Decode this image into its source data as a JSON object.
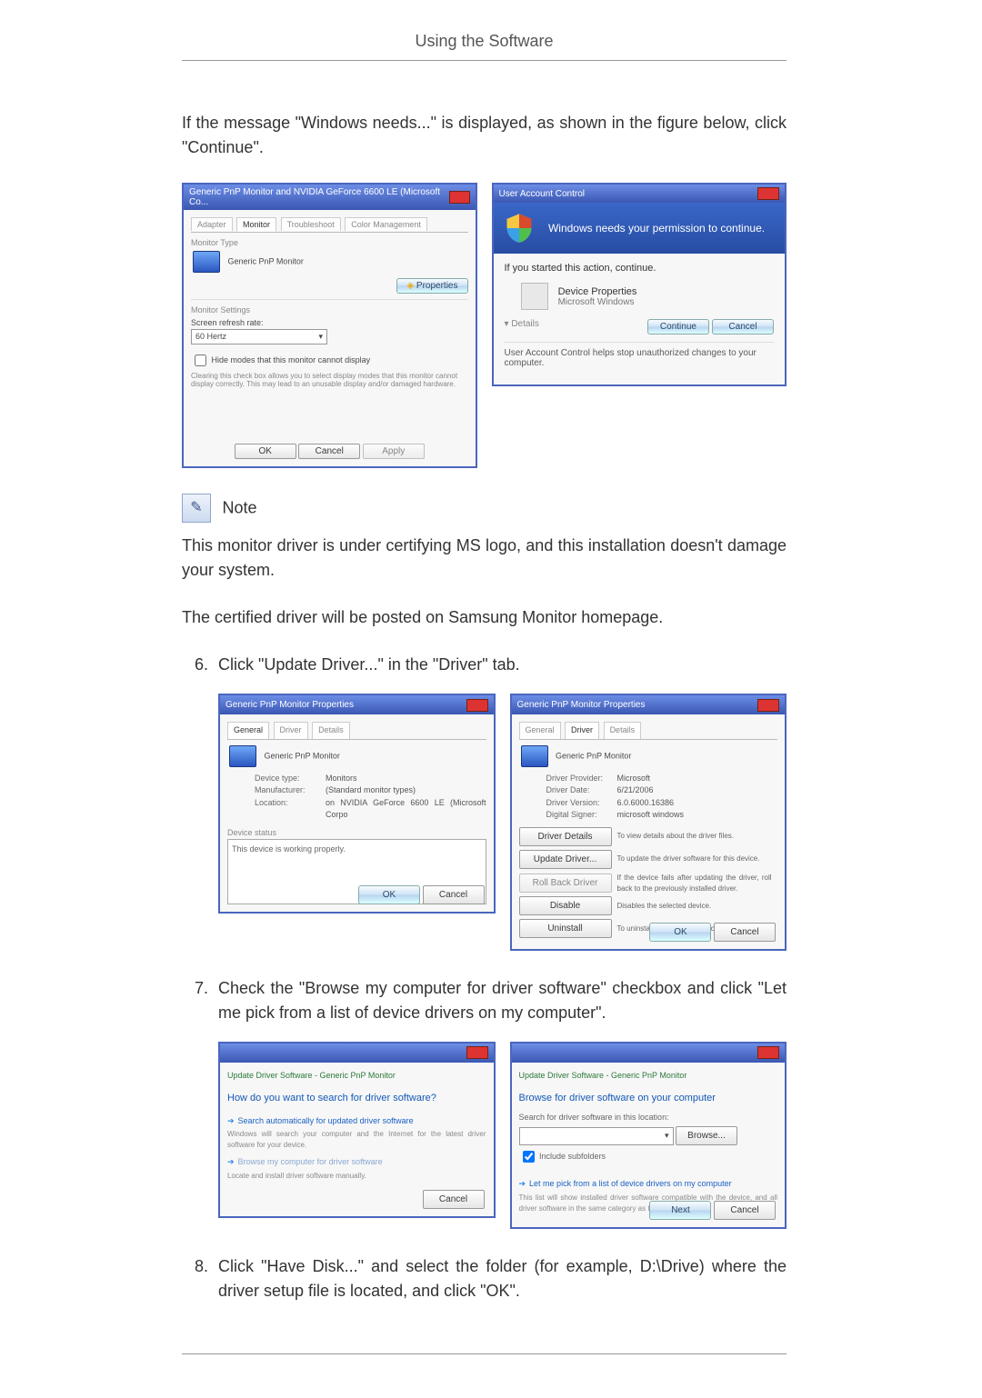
{
  "header": {
    "title": "Using the Software"
  },
  "intro": "If the message \"Windows needs...\" is displayed, as shown in the figure below, click \"Continue\".",
  "fig1": {
    "left": {
      "title": "Generic PnP Monitor and NVIDIA GeForce 6600 LE (Microsoft Co...",
      "tabs": {
        "t1": "Adapter",
        "t2": "Monitor",
        "t3": "Troubleshoot",
        "t4": "Color Management"
      },
      "monitor_type_label": "Monitor Type",
      "monitor_type_value": "Generic PnP Monitor",
      "properties_btn": "Properties",
      "settings_label": "Monitor Settings",
      "refresh_label": "Screen refresh rate:",
      "refresh_value": "60 Hertz",
      "hide_modes_label": "Hide modes that this monitor cannot display",
      "hide_modes_note": "Clearing this check box allows you to select display modes that this monitor cannot display correctly. This may lead to an unusable display and/or damaged hardware.",
      "ok": "OK",
      "cancel": "Cancel",
      "apply": "Apply"
    },
    "right": {
      "title": "User Account Control",
      "banner": "Windows needs your permission to continue.",
      "prompt": "If you started this action, continue.",
      "item_title": "Device Properties",
      "item_vendor": "Microsoft Windows",
      "details": "Details",
      "continue": "Continue",
      "cancel": "Cancel",
      "footer": "User Account Control helps stop unauthorized changes to your computer."
    }
  },
  "note": {
    "label": "Note",
    "p1": "This monitor driver is under certifying MS logo, and this installation doesn't damage your system.",
    "p2": "The certified driver will be posted on Samsung Monitor homepage."
  },
  "steps": {
    "s6": "Click \"Update Driver...\" in the \"Driver\" tab.",
    "s7": "Check the \"Browse my computer for driver software\" checkbox and click \"Let me pick from a list of device drivers on my computer\".",
    "s8": "Click \"Have Disk...\" and select the folder (for example, D:\\Drive) where the driver setup file is located, and click \"OK\"."
  },
  "fig2": {
    "left": {
      "title": "Generic PnP Monitor Properties",
      "tabs": {
        "t1": "General",
        "t2": "Driver",
        "t3": "Details"
      },
      "name": "Generic PnP Monitor",
      "device_type_k": "Device type:",
      "device_type_v": "Monitors",
      "manufacturer_k": "Manufacturer:",
      "manufacturer_v": "(Standard monitor types)",
      "location_k": "Location:",
      "location_v": "on NVIDIA GeForce 6600 LE (Microsoft Corpo",
      "status_label": "Device status",
      "status_text": "This device is working properly.",
      "ok": "OK",
      "cancel": "Cancel"
    },
    "right": {
      "title": "Generic PnP Monitor Properties",
      "tabs": {
        "t1": "General",
        "t2": "Driver",
        "t3": "Details"
      },
      "name": "Generic PnP Monitor",
      "provider_k": "Driver Provider:",
      "provider_v": "Microsoft",
      "date_k": "Driver Date:",
      "date_v": "6/21/2006",
      "version_k": "Driver Version:",
      "version_v": "6.0.6000.16386",
      "signer_k": "Digital Signer:",
      "signer_v": "microsoft windows",
      "b_details": "Driver Details",
      "b_details_d": "To view details about the driver files.",
      "b_update": "Update Driver...",
      "b_update_d": "To update the driver software for this device.",
      "b_roll": "Roll Back Driver",
      "b_roll_d": "If the device fails after updating the driver, roll back to the previously installed driver.",
      "b_disable": "Disable",
      "b_disable_d": "Disables the selected device.",
      "b_uninstall": "Uninstall",
      "b_uninstall_d": "To uninstall the driver (Advanced).",
      "ok": "OK",
      "cancel": "Cancel"
    }
  },
  "fig3": {
    "left": {
      "title": "Update Driver Software - Generic PnP Monitor",
      "question": "How do you want to search for driver software?",
      "opt1": "Search automatically for updated driver software",
      "opt1sub": "Windows will search your computer and the Internet for the latest driver software for your device.",
      "opt2": "Browse my computer for driver software",
      "opt2sub": "Locate and install driver software manually.",
      "cancel": "Cancel"
    },
    "right": {
      "title": "Update Driver Software - Generic PnP Monitor",
      "heading": "Browse for driver software on your computer",
      "search_label": "Search for driver software in this location:",
      "browse": "Browse...",
      "include": "Include subfolders",
      "pick": "Let me pick from a list of device drivers on my computer",
      "picksub": "This list will show installed driver software compatible with the device, and all driver software in the same category as the device.",
      "next": "Next",
      "cancel": "Cancel"
    }
  }
}
